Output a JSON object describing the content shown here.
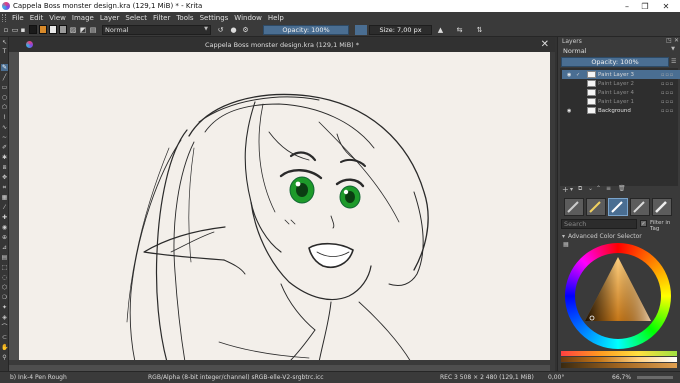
{
  "window": {
    "title": "Cappela Boss monster design.kra (129,1 MiB) * - Krita",
    "minimize": "–",
    "maximize": "❐",
    "close": "✕"
  },
  "menubar": {
    "items": [
      "File",
      "Edit",
      "View",
      "Image",
      "Layer",
      "Select",
      "Filter",
      "Tools",
      "Settings",
      "Window",
      "Help"
    ]
  },
  "toolbar": {
    "blend_mode": "Normal",
    "opacity": "Opacity: 100%",
    "size": "Size: 7,00 px",
    "foreground_color": "#1a1a1a",
    "background_color": "#e8e8e8",
    "swatch_color": "#d88a2a"
  },
  "document": {
    "tab_title": "Cappela Boss monster design.kra (129,1 MiB) *",
    "close": "✕"
  },
  "statusbar": {
    "brush_preset": "b) Ink-4 Pen Rough",
    "color_space": "RGB/Alpha (8-bit integer/channel)  sRGB-elle-V2-srgbtrc.icc",
    "image_size": "REC  3 508 × 2 480 (129,1 MiB)",
    "rotation": "0,00°",
    "zoom": "66,7%"
  },
  "layers_docker": {
    "title": "Layers",
    "blend_mode": "Normal",
    "opacity": "Opacity:  100%",
    "layers": [
      {
        "name": "Paint Layer 3",
        "active": true,
        "visible": true
      },
      {
        "name": "Paint Layer 2",
        "active": false,
        "visible": false
      },
      {
        "name": "Paint Layer 4",
        "active": false,
        "visible": false
      },
      {
        "name": "Paint Layer 1",
        "active": false,
        "visible": false
      },
      {
        "name": "Background",
        "active": false,
        "visible": true
      }
    ]
  },
  "brush_presets": {
    "search_placeholder": "Search",
    "filter_label": "Filter in Tag"
  },
  "color_selector": {
    "title": "Advanced Color Selector"
  },
  "accent_color": "#4a6e92"
}
